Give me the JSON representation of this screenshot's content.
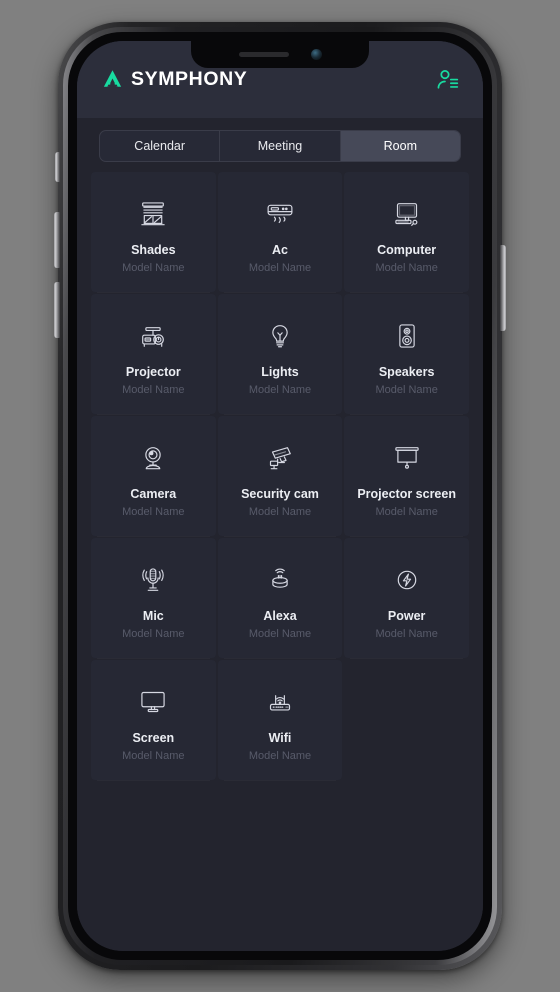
{
  "device": {
    "frame": "iphone-x",
    "notch": {
      "speaker": "earpiece-speaker",
      "camera": "front-camera"
    },
    "buttons": [
      "silent-switch",
      "volume-up",
      "volume-down",
      "power"
    ]
  },
  "colors": {
    "accent": "#18dba0",
    "screen_bg": "#23242e",
    "appbar_bg": "#2c2e3b",
    "card_bg": "#262834",
    "tab_active_bg": "#464958",
    "title_text": "#eceef3",
    "sub_text": "#585b6a",
    "icon_stroke": "#d6d8e2"
  },
  "appbar": {
    "logo_icon": "symphony-logo-icon",
    "brand": "SYMPHONY",
    "profile_icon": "profile-contact-icon"
  },
  "tabs": [
    {
      "label": "Calendar",
      "active": false
    },
    {
      "label": "Meeting",
      "active": false
    },
    {
      "label": "Room",
      "active": true
    }
  ],
  "devices": [
    {
      "title": "Shades",
      "subtitle": "Model Name",
      "icon": "shades-icon"
    },
    {
      "title": "Ac",
      "subtitle": "Model Name",
      "icon": "air-conditioner-icon"
    },
    {
      "title": "Computer",
      "subtitle": "Model Name",
      "icon": "computer-icon"
    },
    {
      "title": "Projector",
      "subtitle": "Model Name",
      "icon": "projector-icon"
    },
    {
      "title": "Lights",
      "subtitle": "Model Name",
      "icon": "lightbulb-icon"
    },
    {
      "title": "Speakers",
      "subtitle": "Model Name",
      "icon": "speaker-icon"
    },
    {
      "title": "Camera",
      "subtitle": "Model Name",
      "icon": "webcam-icon"
    },
    {
      "title": "Security cam",
      "subtitle": "Model Name",
      "icon": "security-camera-icon"
    },
    {
      "title": "Projector screen",
      "subtitle": "Model Name",
      "icon": "projector-screen-icon"
    },
    {
      "title": "Mic",
      "subtitle": "Model Name",
      "icon": "microphone-icon"
    },
    {
      "title": "Alexa",
      "subtitle": "Model Name",
      "icon": "smart-speaker-icon"
    },
    {
      "title": "Power",
      "subtitle": "Model Name",
      "icon": "power-bolt-icon"
    },
    {
      "title": "Screen",
      "subtitle": "Model Name",
      "icon": "monitor-icon"
    },
    {
      "title": "Wifi",
      "subtitle": "Model Name",
      "icon": "wifi-router-icon"
    }
  ]
}
